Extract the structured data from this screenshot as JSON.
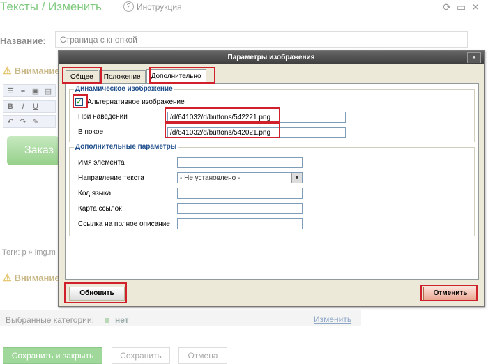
{
  "background": {
    "title": "Тексты / Изменить",
    "help_label": "Инструкция",
    "name_label": "Название:",
    "name_value": "Страница с кнопкой",
    "warning_label_1": "Внимание",
    "warning_label_2": "Внимание",
    "button_preview_text": "Заказ",
    "tags_text": "Теги: p » img.m",
    "categories_label": "Выбранные категории:",
    "categories_value": "нет",
    "categories_change": "Изменить",
    "save_close_label": "Сохранить и закрыть",
    "save_label": "Сохранить",
    "cancel_label": "Отмена",
    "toolbar_bold": "B",
    "toolbar_italic": "I",
    "toolbar_underline": "U"
  },
  "dialog": {
    "title": "Параметры изображения",
    "close_label": "×",
    "tabs": [
      {
        "label": "Общее"
      },
      {
        "label": "Положение"
      },
      {
        "label": "Дополнительно"
      }
    ],
    "dynamic_section": {
      "legend": "Динамическое изображение",
      "alt_checkbox_label": "Альтернативное изображение",
      "alt_checked": true,
      "hover_label": "При наведении",
      "hover_value": "/d/641032/d/buttons/542221.png",
      "idle_label": "В покое",
      "idle_value": "/d/641032/d/buttons/542021.png"
    },
    "extra_section": {
      "legend": "Дополнительные параметры",
      "element_name_label": "Имя элемента",
      "element_name_value": "",
      "text_direction_label": "Направление текста",
      "text_direction_value": "- Не установлено -",
      "lang_code_label": "Код языка",
      "lang_code_value": "",
      "link_map_label": "Карта ссылок",
      "link_map_value": "",
      "long_desc_label": "Ссылка на полное описание",
      "long_desc_value": ""
    },
    "update_label": "Обновить",
    "cancel_label": "Отменить"
  },
  "colors": {
    "highlight": "#d0202b",
    "legend_text": "#1f4e8c",
    "title_bar": "#4a4a4a",
    "accent_green": "#7fc97f"
  }
}
